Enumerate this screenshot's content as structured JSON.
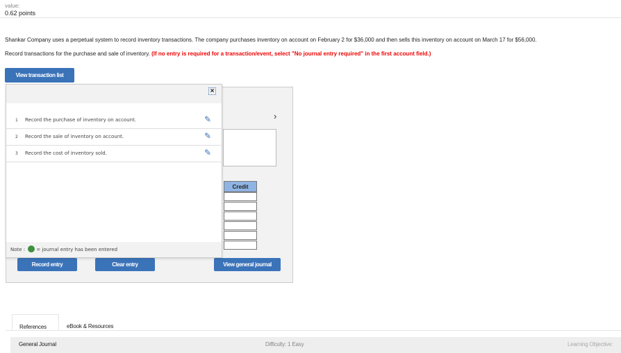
{
  "header": {
    "value_label": "value:",
    "points": "0.62 points"
  },
  "question": {
    "text": "Shankar Company uses a perpetual system to record inventory transactions. The company purchases inventory on account on February 2 for $36,000 and then sells this inventory on account on March 17 for $56,000.",
    "instruction": "Record transactions for the purchase and sale of inventory.",
    "instruction_note": "(If no entry is required for a transaction/event, select \"No journal entry required\" in the first account field.)"
  },
  "view_transaction_list": "View transaction list",
  "popup": {
    "close_icon": "close-icon",
    "items": [
      {
        "num": "1",
        "label": "Record the purchase of inventory on account."
      },
      {
        "num": "2",
        "label": "Record the sale of inventory on account."
      },
      {
        "num": "3",
        "label": "Record the cost of inventory sold."
      }
    ],
    "note_prefix": "Note :",
    "note_text": "= journal entry has been entered",
    "note_color": "#3f8f3f"
  },
  "journal": {
    "credit_header": "Credit",
    "next_icon": "chevron-right-icon"
  },
  "buttons": {
    "record": "Record entry",
    "clear": "Clear entry",
    "view_journal": "View general journal"
  },
  "tabs": [
    {
      "label": "References",
      "active": true
    },
    {
      "label": "eBook & Resources",
      "active": false
    }
  ],
  "reference_bar": {
    "title": "General Journal",
    "difficulty": "Difficulty: 1 Easy",
    "objective": "Learning Objective:"
  },
  "colors": {
    "accent": "#3b73b9",
    "warning": "#e00000"
  }
}
